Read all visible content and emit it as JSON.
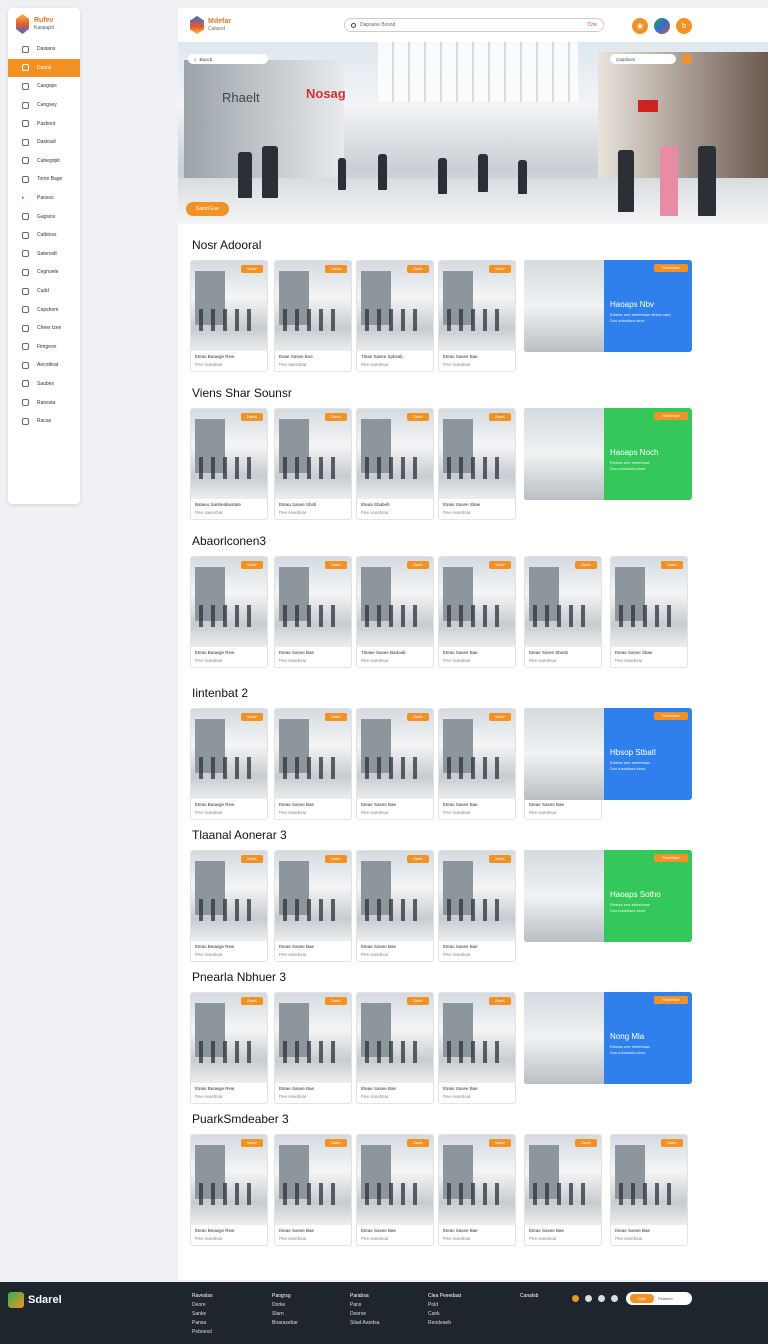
{
  "sidebar": {
    "logo": {
      "title": "Rufev",
      "subtitle": "Kaspapd"
    },
    "items": [
      {
        "label": "Dastans",
        "icon": "home-icon",
        "active": false
      },
      {
        "label": "Dasnk",
        "icon": "store-icon",
        "active": true
      },
      {
        "label": "Cangsps",
        "icon": "tag-icon",
        "active": false
      },
      {
        "label": "Cangsey",
        "icon": "bag-icon",
        "active": false
      },
      {
        "label": "Pasbnot",
        "icon": "box-icon",
        "active": false
      },
      {
        "label": "Dastoad",
        "icon": "file-icon",
        "active": false
      },
      {
        "label": "Cabegopit",
        "icon": "grid-icon",
        "active": false
      },
      {
        "label": "Tome Bage",
        "icon": "cart-icon",
        "active": false
      },
      {
        "label": "Pansos",
        "icon": "chevron-right-icon",
        "active": false
      },
      {
        "label": "Gagsios",
        "icon": "user-icon",
        "active": false
      },
      {
        "label": "Catbioss",
        "icon": "folder-icon",
        "active": false
      },
      {
        "label": "Satensdt",
        "icon": "camera-icon",
        "active": false
      },
      {
        "label": "Cegnoele",
        "icon": "settings-icon",
        "active": false
      },
      {
        "label": "Cudd",
        "icon": "check-icon",
        "active": false
      },
      {
        "label": "Cepsbom",
        "icon": "star-icon",
        "active": false
      },
      {
        "label": "Cheer tzen",
        "icon": "link-icon",
        "active": false
      },
      {
        "label": "Fimgeon",
        "icon": "heart-icon",
        "active": false
      },
      {
        "label": "Aecodeat",
        "icon": "chart-icon",
        "active": false
      },
      {
        "label": "Saubes",
        "icon": "gift-icon",
        "active": false
      },
      {
        "label": "Ranssta",
        "icon": "bell-icon",
        "active": false
      },
      {
        "label": "Racas",
        "icon": "gear-icon",
        "active": false
      }
    ]
  },
  "header": {
    "logo": {
      "title": "Mdefar",
      "subtitle": "Caluest"
    },
    "search": {
      "value": "Dapsane Bssnd",
      "clear_label": "Cne"
    },
    "icons": [
      "orange-button-icon",
      "globe-icon",
      "user-icon"
    ]
  },
  "hero": {
    "chip_left": "Baocb",
    "chip_right": "Capsbom",
    "badge": "Sastd Ese",
    "signs": [
      "Nosag",
      "Rhaelt"
    ]
  },
  "sections": [
    {
      "title": "Nosr Adooral",
      "cards": [
        {
          "tag": "Daelx",
          "l1": "Eteas Beawge Rew",
          "l2": "Pee sseebsar"
        },
        {
          "tag": "Caelox",
          "l1": "Eeae Sasee Boe",
          "l2": "Pee saesnbar"
        },
        {
          "tag": "Daelx",
          "l1": "Tleae Sasee Spbsab",
          "l2": "Pee sseebsar"
        },
        {
          "tag": "Daelx",
          "l1": "Eteas Sasee Bae",
          "l2": "Pee sseebsar"
        }
      ],
      "promo": {
        "tag": "Fteat Bdoe",
        "title": "Haoaps Nbv",
        "sub": "Eteeas serr eebebsaw ebsee sarb\nDos erbodsea sboe",
        "color": "#2f80ed"
      }
    },
    {
      "title": "Viens Shar Sounsr",
      "cards": [
        {
          "tag": "Dabdx",
          "l1": "Bataeo Sanbeabeatate",
          "l2": "Pee saesnbar"
        },
        {
          "tag": "Dabcx",
          "l1": "Eteaa Sasee Sbsb",
          "l2": "Pee sseebsar"
        },
        {
          "tag": "Daelx",
          "l1": "Eteaa Sbabeb",
          "l2": "Pee sseebsar"
        },
        {
          "tag": "Daelx",
          "l1": "Eteas Sasee Sbae",
          "l2": "Pee sseebsar"
        }
      ],
      "promo": {
        "tag": "Fteat Bdoe",
        "title": "Haoaps Noch",
        "sub": "Eteeas serr eebebsaw\nDos ersdotses sboe",
        "color": "#34c759"
      }
    },
    {
      "title": "Abaorlconen3",
      "cards": [
        {
          "tag": "Daelx",
          "l1": "Eteas Beawge Rew",
          "l2": "Pee sseebsar"
        },
        {
          "tag": "Daelx",
          "l1": "Eteae Sasee Bae",
          "l2": "Pee sseebsar"
        },
        {
          "tag": "Daelx",
          "l1": "Tleaee Sasee Badoab",
          "l2": "Pee sseebsar"
        },
        {
          "tag": "Daelx",
          "l1": "Eteas Sasee Bae",
          "l2": "Pee sseebsar"
        },
        {
          "tag": "Daelx",
          "l1": "Eteae Saree Sbesb",
          "l2": "Pee sseebsar"
        },
        {
          "tag": "Daelx",
          "l1": "Eteae Sasee Sbae",
          "l2": "Pee sseebsar"
        }
      ],
      "promo": null
    },
    {
      "title": "Iintenbat 2",
      "cards": [
        {
          "tag": "Daelx",
          "l1": "Eteas Beawge Rew",
          "l2": "Pee sseebsar"
        },
        {
          "tag": "Daelx",
          "l1": "Eteae Sasee Bae",
          "l2": "Pee sseebsar"
        },
        {
          "tag": "Daelx",
          "l1": "Eteae Sasee Bae",
          "l2": "Pee sseebsar"
        },
        {
          "tag": "Daelx",
          "l1": "Eteas Sasee Bae",
          "l2": "Pee sseebsar"
        },
        {
          "tag": "Daelx",
          "l1": "Eteae Sasee Bae",
          "l2": "Pee sseebsar"
        }
      ],
      "promo": {
        "tag": "Fteat Bdoe",
        "title": "Hbsop Stbatl",
        "sub": "Eteeas serr eebebsaw\nDos ersdotses sboe",
        "color": "#2f80ed"
      }
    },
    {
      "title": "Tlaanal Aonerar 3",
      "cards": [
        {
          "tag": "Daelx",
          "l1": "Eteas Beawge Rew",
          "l2": "Pee sseebsar"
        },
        {
          "tag": "Daelx",
          "l1": "Eteae Sasee Bae",
          "l2": "Pee sseebsar"
        },
        {
          "tag": "Daelx",
          "l1": "Eteae Sasee Bae",
          "l2": "Pee sseebsar"
        },
        {
          "tag": "Daelx",
          "l1": "Eteas Sasee Bae",
          "l2": "Pee sseebsar"
        }
      ],
      "promo": {
        "tag": "Fteat Bdoe",
        "title": "Haoaps Sotho",
        "sub": "Eteeas serr eebebsaw\nDos ersdotses sboe",
        "color": "#34c759"
      }
    },
    {
      "title": "Pnearla Nbhuer 3",
      "cards": [
        {
          "tag": "Daelx",
          "l1": "Eteas Beawge Rew",
          "l2": "Pee sseebsar"
        },
        {
          "tag": "Daelx",
          "l1": "Eteae Sasee Bae",
          "l2": "Pee sseebsar"
        },
        {
          "tag": "Daelx",
          "l1": "Eteae Sasee Bae",
          "l2": "Pee sseebsar"
        },
        {
          "tag": "Daelx",
          "l1": "Eteas Sasee Bae",
          "l2": "Pee sseebsar"
        }
      ],
      "promo": {
        "tag": "Fteat Bdoe",
        "title": "Nong Mla",
        "sub": "Eteeas serr eebebsaw\nDos ersdotses sboe",
        "color": "#2f80ed"
      }
    },
    {
      "title": "PuarkSmdeaber 3",
      "cards": [
        {
          "tag": "Daelx",
          "l1": "Eteas Beawge Rew",
          "l2": "Pee sseebsar"
        },
        {
          "tag": "Daelx",
          "l1": "Eteae Sasee Bae",
          "l2": "Pee sseebsar"
        },
        {
          "tag": "Daelx",
          "l1": "Eteae Sasee Bae",
          "l2": "Pee sseebsar"
        },
        {
          "tag": "Daelx",
          "l1": "Eteas Sasee Bae",
          "l2": "Pee sseebsar"
        },
        {
          "tag": "Daelx",
          "l1": "Eteae Sasee Bae",
          "l2": "Pee sseebsar"
        },
        {
          "tag": "Daelx",
          "l1": "Eteae Sasee Bae",
          "l2": "Pee sseebsar"
        }
      ],
      "promo": null
    }
  ],
  "footer": {
    "logo": "Sdarel",
    "columns": [
      {
        "head": "Raveslas",
        "items": [
          "Deore",
          "Sanke",
          "Pansa",
          "Peboesd"
        ]
      },
      {
        "head": "Paogrsg",
        "items": [
          "Dorke",
          "Slarn",
          "Bnarasebar"
        ]
      },
      {
        "head": "Parabsa",
        "items": [
          "Pans",
          "Deorse",
          "Sitad Aandsa"
        ]
      },
      {
        "head": "Clea Peeedaat",
        "items": [
          "Pold",
          "Cank",
          "Reodeaeb"
        ]
      },
      {
        "head": "Canalsb",
        "items": []
      }
    ],
    "subscribe": {
      "button": "Dab",
      "placeholder": "Peaaleb"
    }
  }
}
